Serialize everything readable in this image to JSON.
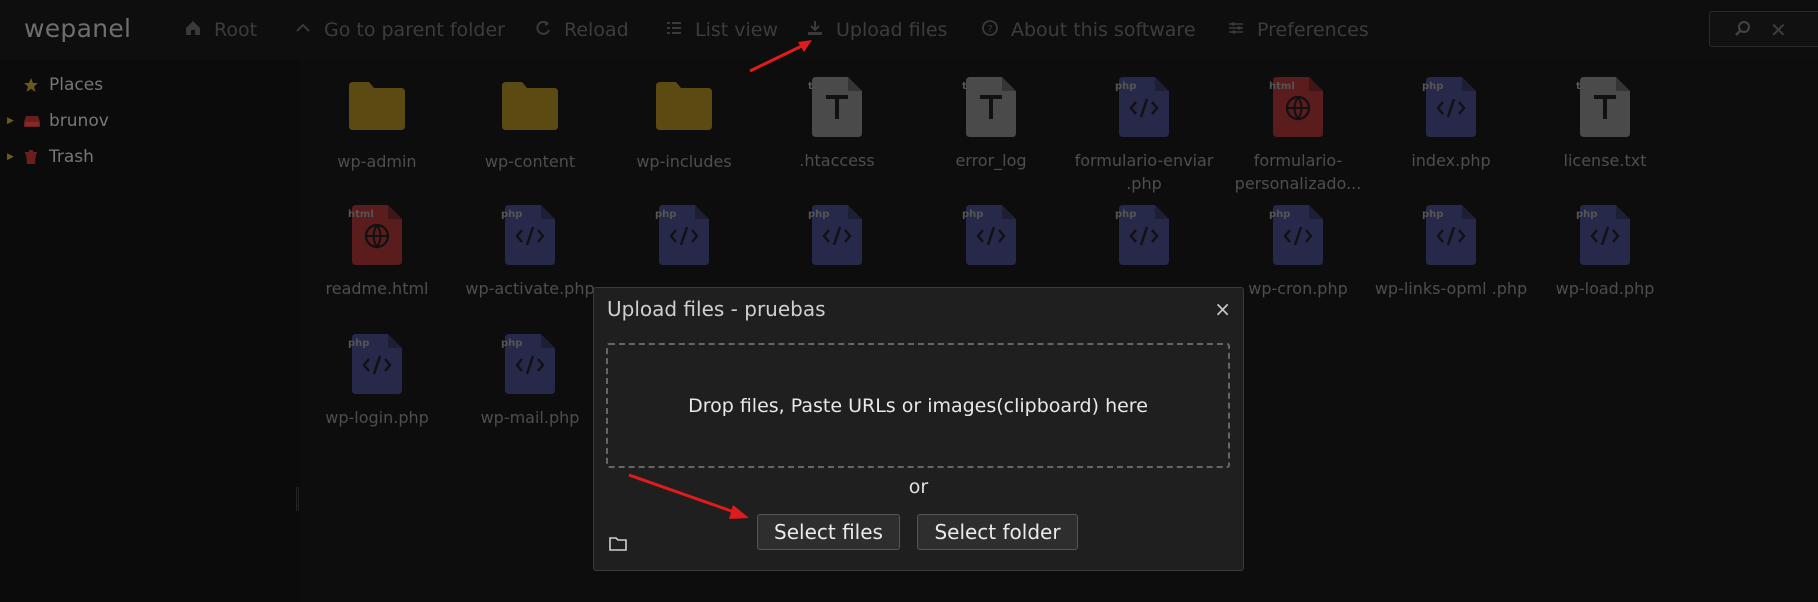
{
  "app": {
    "logo": "wepanel"
  },
  "toolbar": {
    "items": [
      {
        "label": "Root",
        "icon": "home-icon"
      },
      {
        "label": "Go to parent folder",
        "icon": "chevron-up-icon"
      },
      {
        "label": "Reload",
        "icon": "reload-icon"
      },
      {
        "label": "List view",
        "icon": "list-icon"
      },
      {
        "label": "Upload files",
        "icon": "upload-icon"
      },
      {
        "label": "About this software",
        "icon": "help-icon"
      },
      {
        "label": "Preferences",
        "icon": "sliders-icon"
      }
    ]
  },
  "sidebar": {
    "items": [
      {
        "label": "Places",
        "icon": "star-icon"
      },
      {
        "label": "brunov",
        "icon": "drive-icon"
      },
      {
        "label": "Trash",
        "icon": "trash-icon"
      }
    ]
  },
  "files": [
    {
      "name": "wp-admin",
      "kind": "folder"
    },
    {
      "name": "wp-content",
      "kind": "folder"
    },
    {
      "name": "wp-includes",
      "kind": "folder"
    },
    {
      "name": ".htaccess",
      "kind": "text",
      "ext": "t"
    },
    {
      "name": "error_log",
      "kind": "text",
      "ext": "t"
    },
    {
      "name": "formulario-enviar .php",
      "kind": "php",
      "ext": "php"
    },
    {
      "name": "formulario- personalizado...",
      "kind": "html",
      "ext": "html"
    },
    {
      "name": "index.php",
      "kind": "php",
      "ext": "php"
    },
    {
      "name": "license.txt",
      "kind": "text",
      "ext": "t"
    },
    {
      "name": "readme.html",
      "kind": "html",
      "ext": "html"
    },
    {
      "name": "wp-activate.php",
      "kind": "php",
      "ext": "php"
    },
    {
      "name": "",
      "kind": "php",
      "ext": "php"
    },
    {
      "name": "",
      "kind": "php",
      "ext": "php"
    },
    {
      "name": "",
      "kind": "php",
      "ext": "php"
    },
    {
      "name": "",
      "kind": "php",
      "ext": "php"
    },
    {
      "name": "wp-cron.php",
      "kind": "php",
      "ext": "php"
    },
    {
      "name": "wp-links-opml .php",
      "kind": "php",
      "ext": "php"
    },
    {
      "name": "wp-load.php",
      "kind": "php",
      "ext": "php"
    },
    {
      "name": "wp-login.php",
      "kind": "php",
      "ext": "php"
    },
    {
      "name": "wp-mail.php",
      "kind": "php",
      "ext": "php"
    }
  ],
  "modal": {
    "title": "Upload files - pruebas",
    "close": "×",
    "dropzone_text": "Drop files, Paste URLs or images(clipboard) here",
    "or_text": "or",
    "select_files_label": "Select files",
    "select_folder_label": "Select folder"
  },
  "colors": {
    "folder": "#5b4a12",
    "text_file": "#4a4a4a",
    "php_file": "#27294a",
    "html_file": "#5a1c1c",
    "annotation_arrow": "#e01b1b"
  }
}
